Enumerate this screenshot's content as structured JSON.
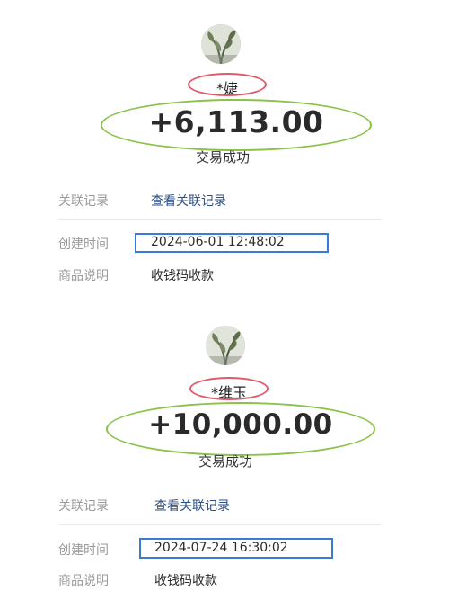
{
  "transactions": [
    {
      "payer_name": "*婕",
      "amount": "+6,113.00",
      "status": "交易成功",
      "related_label": "关联记录",
      "related_link": "查看关联记录",
      "created_label": "创建时间",
      "created_value": "2024-06-01 12:48:02",
      "desc_label": "商品说明",
      "desc_value": "收钱码收款"
    },
    {
      "payer_name": "*维玉",
      "amount": "+10,000.00",
      "status": "交易成功",
      "related_label": "关联记录",
      "related_link": "查看关联记录",
      "created_label": "创建时间",
      "created_value": "2024-07-24 16:30:02",
      "desc_label": "商品说明",
      "desc_value": "收钱码收款"
    }
  ],
  "annotations": {
    "name_oval_color": "#e05a68",
    "amount_oval_color": "#8ac34a",
    "time_box_color": "#3a7bd5"
  },
  "icons": {
    "avatar": "plant-photo-avatar"
  }
}
